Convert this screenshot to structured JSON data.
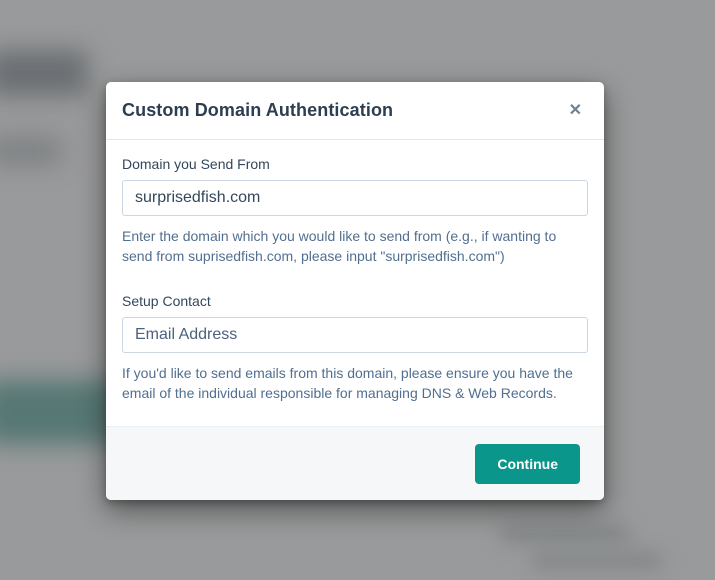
{
  "modal": {
    "title": "Custom Domain Authentication",
    "close_icon": "✕",
    "domain_field": {
      "label": "Domain you Send From",
      "value": "surprisedfish.com",
      "help": "Enter the domain which you would like to send from (e.g., if wanting to send from suprisedfish.com, please input \"surprisedfish.com\")"
    },
    "contact_field": {
      "label": "Setup Contact",
      "placeholder": "Email Address",
      "help": "If you'd like to send emails from this domain, please ensure you have the email of the individual responsible for managing DNS & Web Records."
    },
    "footer": {
      "continue_label": "Continue"
    }
  },
  "colors": {
    "accent_button": "#0b968b",
    "title_text": "#2d3e50",
    "helper_text": "#516f90",
    "input_border": "#cbd6e2",
    "footer_bg": "#f5f7f9",
    "overlay_bg": "#999a9b"
  }
}
